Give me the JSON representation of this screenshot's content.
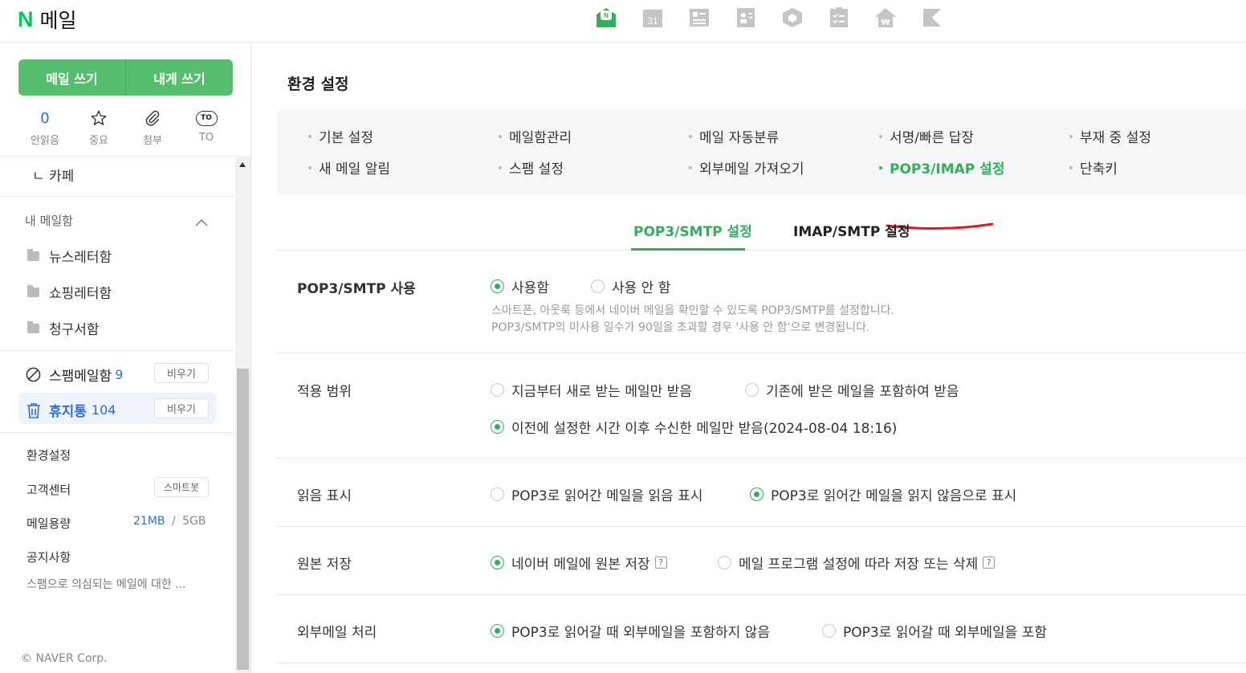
{
  "header": {
    "logo_letter": "N",
    "logo_text": "메일",
    "apps": [
      "mail-icon",
      "calendar-icon",
      "news-icon",
      "contacts-icon",
      "mybox-icon",
      "todo-icon",
      "pay-icon",
      "bookmark-icon"
    ],
    "calendar_day": "31"
  },
  "sidebar": {
    "write_mail": "메일 쓰기",
    "write_self": "내게 쓰기",
    "quick": [
      {
        "value": "0",
        "label": "안읽음"
      },
      {
        "icon": "star-icon",
        "label": "중요"
      },
      {
        "icon": "paperclip-icon",
        "label": "첨부"
      },
      {
        "icon_text": "TO",
        "label": "TO"
      }
    ],
    "cafe": "ㄴ 카페",
    "my_mailbox": "내 메일함",
    "folders": [
      "뉴스레터함",
      "쇼핑레터함",
      "청구서함"
    ],
    "spam": {
      "label": "스팸메일함",
      "count": "9",
      "button": "비우기"
    },
    "trash": {
      "label": "휴지통",
      "count": "104",
      "button": "비우기"
    },
    "settings": "환경설정",
    "support": "고객센터",
    "smartbot": "스마트봇",
    "storage_label": "메일용량",
    "storage_used": "21MB",
    "storage_sep": "/",
    "storage_total": "5GB",
    "notice_title": "공지사항",
    "notice_text": "스팸으로 의심되는 메일에 대한 ...",
    "copyright": "© NAVER Corp."
  },
  "main": {
    "title": "환경 설정",
    "nav": [
      [
        "기본 설정",
        "메일함관리",
        "메일 자동분류",
        "서명/빠른 답장",
        "부재 중 설정"
      ],
      [
        "새 메일 알림",
        "스팸 설정",
        "외부메일 가져오기",
        "POP3/IMAP 설정",
        "단축키"
      ]
    ],
    "tabs": [
      "POP3/SMTP 설정",
      "IMAP/SMTP 설정"
    ],
    "rows": {
      "use": {
        "label": "POP3/SMTP 사용",
        "on": "사용함",
        "off": "사용 안 함",
        "desc1": "스마트폰, 아웃룩 등에서 네이버 메일을 확인할 수 있도록 POP3/SMTP를 설정합니다.",
        "desc2": "POP3/SMTP의 미사용 일수가 90일을 초과할 경우 '사용 안 함'으로 변경됩니다."
      },
      "scope": {
        "label": "적용 범위",
        "opt1": "지금부터 새로 받는 메일만 받음",
        "opt2": "기존에 받은 메일을 포함하여 받음",
        "opt3": "이전에 설정한 시간 이후 수신한 메일만 받음(2024-08-04 18:16)"
      },
      "read": {
        "label": "읽음 표시",
        "opt1": "POP3로 읽어간 메일을 읽음 표시",
        "opt2": "POP3로 읽어간 메일을 읽지 않음으로 표시"
      },
      "keep": {
        "label": "원본 저장",
        "opt1": "네이버 메일에 원본 저장",
        "opt2": "메일 프로그램 설정에 따라 저장 또는 삭제",
        "help": "?"
      },
      "external": {
        "label": "외부메일 처리",
        "opt1": "POP3로 읽어갈 때 외부메일을 포함하지 않음",
        "opt2": "POP3로 읽어갈 때 외부메일을 포함"
      }
    }
  },
  "colors": {
    "accent": "#2fb15a",
    "button": "#55bf6f",
    "annotation": "#e0171f"
  }
}
